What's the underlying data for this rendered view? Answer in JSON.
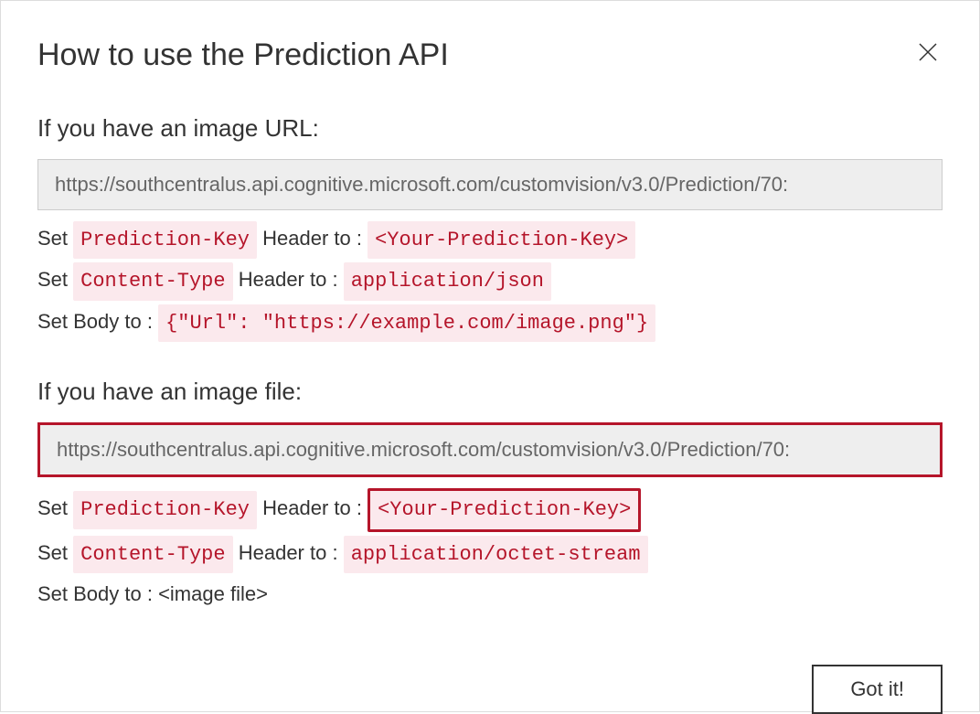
{
  "dialog": {
    "title": "How to use the Prediction API",
    "gotItLabel": "Got it!"
  },
  "urlSection": {
    "title": "If you have an image URL:",
    "endpoint": "https://southcentralus.api.cognitive.microsoft.com/customvision/v3.0/Prediction/70:",
    "line1_prefix": "Set",
    "line1_token1": "Prediction-Key",
    "line1_mid": "Header to :",
    "line1_token2": "<Your-Prediction-Key>",
    "line2_prefix": "Set",
    "line2_token1": "Content-Type",
    "line2_mid": "Header to :",
    "line2_token2": "application/json",
    "line3_prefix": "Set Body to :",
    "line3_token": "{\"Url\": \"https://example.com/image.png\"}"
  },
  "fileSection": {
    "title": "If you have an image file:",
    "endpoint": "https://southcentralus.api.cognitive.microsoft.com/customvision/v3.0/Prediction/70:",
    "line1_prefix": "Set",
    "line1_token1": "Prediction-Key",
    "line1_mid": "Header to :",
    "line1_token2": "<Your-Prediction-Key>",
    "line2_prefix": "Set",
    "line2_token1": "Content-Type",
    "line2_mid": "Header to :",
    "line2_token2": "application/octet-stream",
    "line3_text": "Set Body to : <image file>"
  }
}
